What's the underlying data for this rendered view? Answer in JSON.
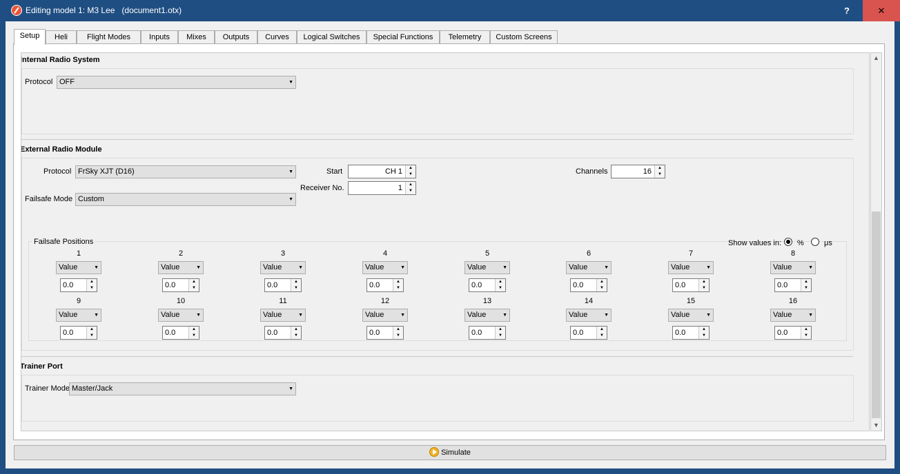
{
  "window": {
    "title": "Editing model 1: M3 Lee   (document1.otx)",
    "help_label": "?",
    "close_label": "✕"
  },
  "tabs": [
    {
      "label": "Setup",
      "active": true
    },
    {
      "label": "Heli"
    },
    {
      "label": "Flight Modes"
    },
    {
      "label": "Inputs"
    },
    {
      "label": "Mixes"
    },
    {
      "label": "Outputs"
    },
    {
      "label": "Curves"
    },
    {
      "label": "Logical Switches"
    },
    {
      "label": "Special Functions"
    },
    {
      "label": "Telemetry"
    },
    {
      "label": "Custom Screens"
    }
  ],
  "internal": {
    "title": "Internal Radio System",
    "protocol_label": "Protocol",
    "protocol_value": "OFF"
  },
  "external": {
    "title": "External Radio Module",
    "protocol_label": "Protocol",
    "protocol_value": "FrSky XJT (D16)",
    "start_label": "Start",
    "start_value": "CH 1",
    "channels_label": "Channels",
    "channels_value": "16",
    "receiver_label": "Receiver No.",
    "receiver_value": "1",
    "failsafe_mode_label": "Failsafe Mode",
    "failsafe_mode_value": "Custom",
    "failsafe_positions_label": "Failsafe Positions",
    "show_values_label": "Show values in:",
    "unit_percent": "%",
    "unit_us": "μs",
    "failsafe_channels": [
      {
        "num": "1",
        "mode": "Value",
        "value": "0.0"
      },
      {
        "num": "2",
        "mode": "Value",
        "value": "0.0"
      },
      {
        "num": "3",
        "mode": "Value",
        "value": "0.0"
      },
      {
        "num": "4",
        "mode": "Value",
        "value": "0.0"
      },
      {
        "num": "5",
        "mode": "Value",
        "value": "0.0"
      },
      {
        "num": "6",
        "mode": "Value",
        "value": "0.0"
      },
      {
        "num": "7",
        "mode": "Value",
        "value": "0.0"
      },
      {
        "num": "8",
        "mode": "Value",
        "value": "0.0"
      },
      {
        "num": "9",
        "mode": "Value",
        "value": "0.0"
      },
      {
        "num": "10",
        "mode": "Value",
        "value": "0.0"
      },
      {
        "num": "11",
        "mode": "Value",
        "value": "0.0"
      },
      {
        "num": "12",
        "mode": "Value",
        "value": "0.0"
      },
      {
        "num": "13",
        "mode": "Value",
        "value": "0.0"
      },
      {
        "num": "14",
        "mode": "Value",
        "value": "0.0"
      },
      {
        "num": "15",
        "mode": "Value",
        "value": "0.0"
      },
      {
        "num": "16",
        "mode": "Value",
        "value": "0.0"
      }
    ]
  },
  "trainer": {
    "title": "Trainer Port",
    "mode_label": "Trainer Mode",
    "mode_value": "Master/Jack"
  },
  "simulate_label": "Simulate"
}
